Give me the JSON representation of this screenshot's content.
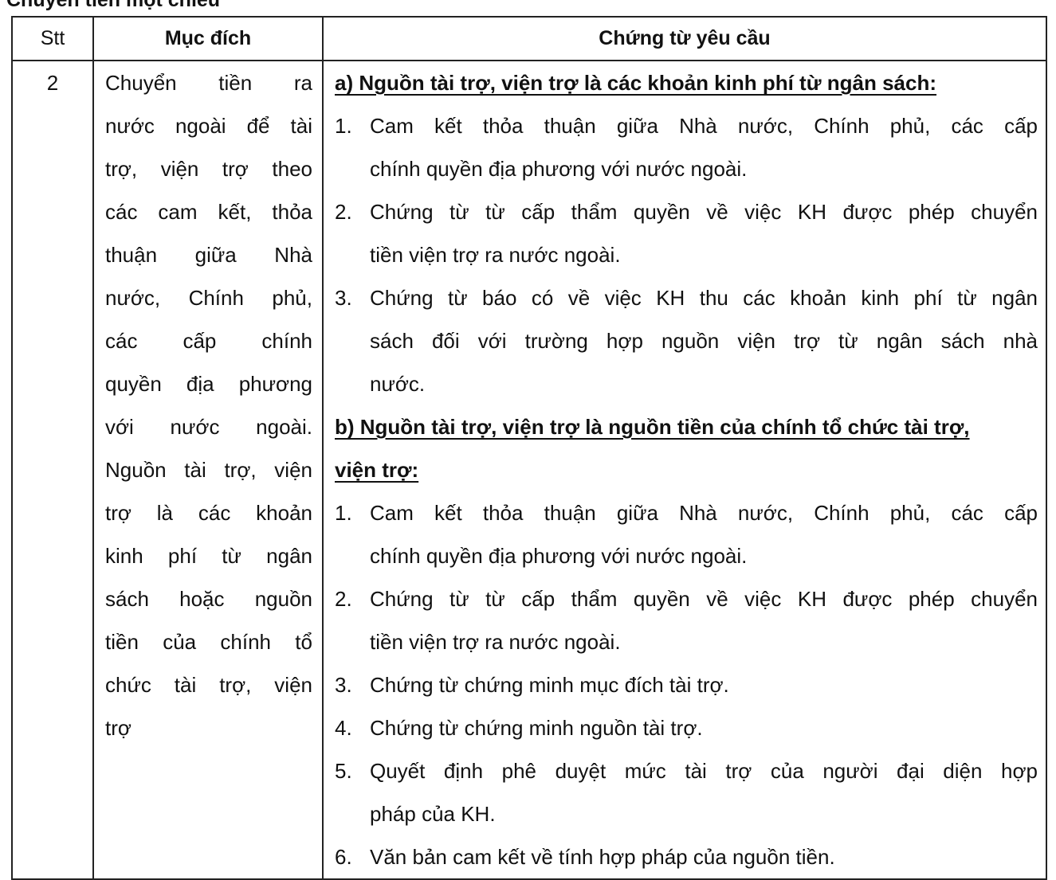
{
  "page_heading": "Chuyển tiền một chiều",
  "table": {
    "headers": {
      "stt": "Stt",
      "purpose": "Mục đích",
      "documents": "Chứng từ yêu cầu"
    },
    "row": {
      "stt": "2",
      "purpose_lines": [
        "Chuyển tiền ra",
        "nước ngoài để tài",
        "trợ, viện trợ theo",
        "các cam kết, thỏa",
        "thuận giữa Nhà",
        "nước, Chính phủ,",
        "các cấp chính",
        "quyền địa phương",
        "với nước ngoài.",
        "Nguồn tài trợ, viện",
        "trợ là các khoản",
        "kinh phí từ ngân",
        "sách hoặc nguồn",
        "tiền của chính tổ",
        "chức tài trợ, viện",
        "trợ"
      ],
      "section_a": {
        "heading": "a) Nguồn tài trợ, viện trợ là các khoản kinh phí từ ngân sách:",
        "items": [
          {
            "num": "1.",
            "lines": [
              "Cam kết thỏa thuận giữa Nhà nước, Chính phủ, các cấp",
              "chính quyền địa phương với nước ngoài."
            ]
          },
          {
            "num": "2.",
            "lines": [
              "Chứng từ từ cấp thẩm quyền về việc KH được phép chuyển",
              "tiền viện trợ ra nước ngoài."
            ]
          },
          {
            "num": "3.",
            "lines": [
              "Chứng từ báo có về việc KH thu các khoản kinh phí từ ngân",
              "sách đối với trường hợp nguồn viện trợ từ ngân sách nhà",
              "nước."
            ]
          }
        ]
      },
      "section_b": {
        "heading_lines": [
          "b) Nguồn tài trợ, viện trợ là nguồn tiền của chính tổ chức tài trợ,",
          "viện trợ:"
        ],
        "items": [
          {
            "num": "1.",
            "lines": [
              "Cam kết thỏa thuận giữa Nhà nước, Chính phủ, các cấp",
              "chính quyền địa phương với nước ngoài."
            ]
          },
          {
            "num": "2.",
            "lines": [
              "Chứng từ từ cấp thẩm quyền về việc KH được phép chuyển",
              "tiền viện trợ ra nước ngoài."
            ]
          },
          {
            "num": "3.",
            "lines": [
              "Chứng từ chứng minh mục đích tài trợ."
            ]
          },
          {
            "num": "4.",
            "lines": [
              "Chứng từ chứng minh nguồn tài trợ."
            ]
          },
          {
            "num": "5.",
            "lines": [
              "Quyết định phê duyệt mức tài trợ của người đại diện hợp",
              "pháp của KH."
            ]
          },
          {
            "num": "6.",
            "lines": [
              "Văn bản cam kết về tính hợp pháp của nguồn tiền."
            ]
          }
        ]
      }
    }
  }
}
